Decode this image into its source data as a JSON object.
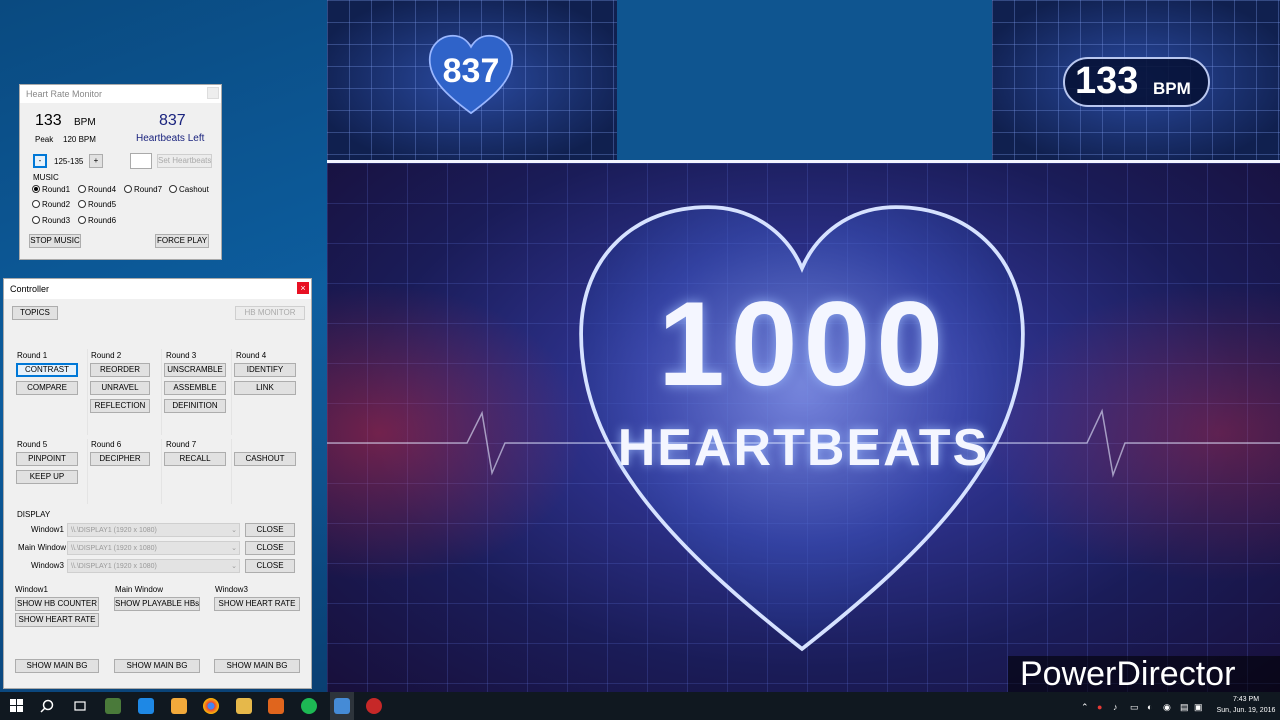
{
  "game": {
    "heartbeats_left_display": "837",
    "bpm_display": "133",
    "bpm_unit": "BPM",
    "logo_line1": "1000",
    "logo_line2": "HEARTBEATS",
    "watermark": "PowerDirector"
  },
  "hrm": {
    "title": "Heart Rate Monitor",
    "bpm_value": "133",
    "bpm_unit": "BPM",
    "peak_label": "Peak",
    "peak_value": "120 BPM",
    "heartbeats_value": "837",
    "heartbeats_label": "Heartbeats Left",
    "minus_label": "-",
    "range_label": "125-135",
    "plus_label": "+",
    "set_heartbeats_label": "Set Heartbeats",
    "music_label": "MUSIC",
    "radios": [
      "Round1",
      "Round4",
      "Round7",
      "Cashout",
      "Round2",
      "Round5",
      "Round3",
      "Round6"
    ],
    "stop_music": "STOP MUSIC",
    "force_play": "FORCE PLAY"
  },
  "controller": {
    "title": "Controller",
    "close": "×",
    "topics": "TOPICS",
    "hb_monitor": "HB MONITOR",
    "round_labels": [
      "Round 1",
      "Round 2",
      "Round 3",
      "Round 4",
      "Round 5",
      "Round 6",
      "Round 7"
    ],
    "r1": [
      "CONTRAST",
      "COMPARE"
    ],
    "r2": [
      "REORDER",
      "UNRAVEL",
      "REFLECTION"
    ],
    "r3": [
      "UNSCRAMBLE",
      "ASSEMBLE",
      "DEFINITION"
    ],
    "r4": [
      "IDENTIFY",
      "LINK"
    ],
    "r5": [
      "PINPOINT",
      "KEEP UP"
    ],
    "r6": [
      "DECIPHER"
    ],
    "r7": [
      "RECALL"
    ],
    "cashout": "CASHOUT",
    "display_label": "DISPLAY",
    "display_rows": [
      {
        "label": "Window1",
        "value": "\\\\.\\DISPLAY1 (1920 x 1080)",
        "close": "CLOSE"
      },
      {
        "label": "Main Window",
        "value": "\\\\.\\DISPLAY1 (1920 x 1080)",
        "close": "CLOSE"
      },
      {
        "label": "Window3",
        "value": "\\\\.\\DISPLAY1 (1920 x 1080)",
        "close": "CLOSE"
      }
    ],
    "col_labels": [
      "Window1",
      "Main Window",
      "Window3"
    ],
    "show_hb_counter": "SHOW HB COUNTER",
    "show_playable_hbs": "SHOW PLAYABLE HBs",
    "show_heart_rate_w3": "SHOW HEART RATE",
    "show_heart_rate_w1": "SHOW HEART RATE",
    "show_main_bg": "SHOW MAIN BG"
  },
  "taskbar": {
    "time": "7:43 PM",
    "date": "Sun, Jun. 19, 2016"
  },
  "colors": {
    "accent": "#0078d7",
    "close_red": "#e81123",
    "heartbeats_blue": "#1a237e"
  }
}
